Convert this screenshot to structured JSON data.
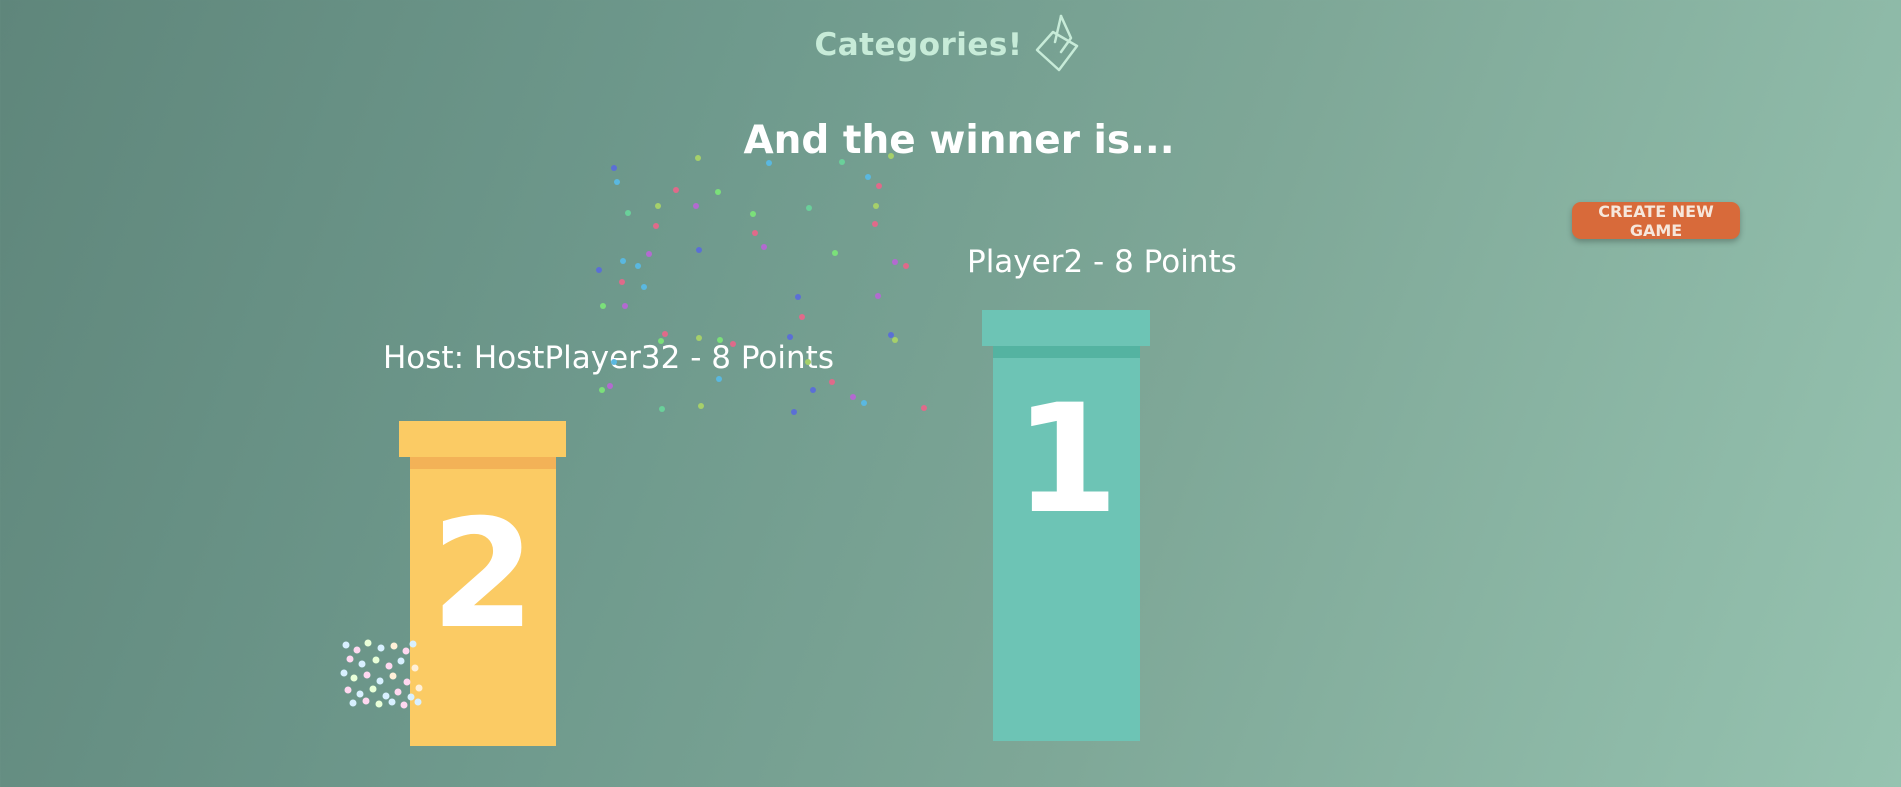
{
  "header": {
    "title": "Categories!",
    "logo_icon": "card-icon"
  },
  "results": {
    "heading": "And the winner is...",
    "first_place": {
      "label": "Player2 - 8 Points",
      "rank": "1",
      "color": "#6dc4b5"
    },
    "second_place": {
      "label": "Host: HostPlayer32 - 8 Points",
      "rank": "2",
      "color": "#fbcb64"
    }
  },
  "actions": {
    "create_game_label": "CREATE NEW GAME",
    "create_game_color": "#d86a3a"
  },
  "theme": {
    "title_color": "#c7ebd8",
    "text_color": "#ffffff"
  }
}
